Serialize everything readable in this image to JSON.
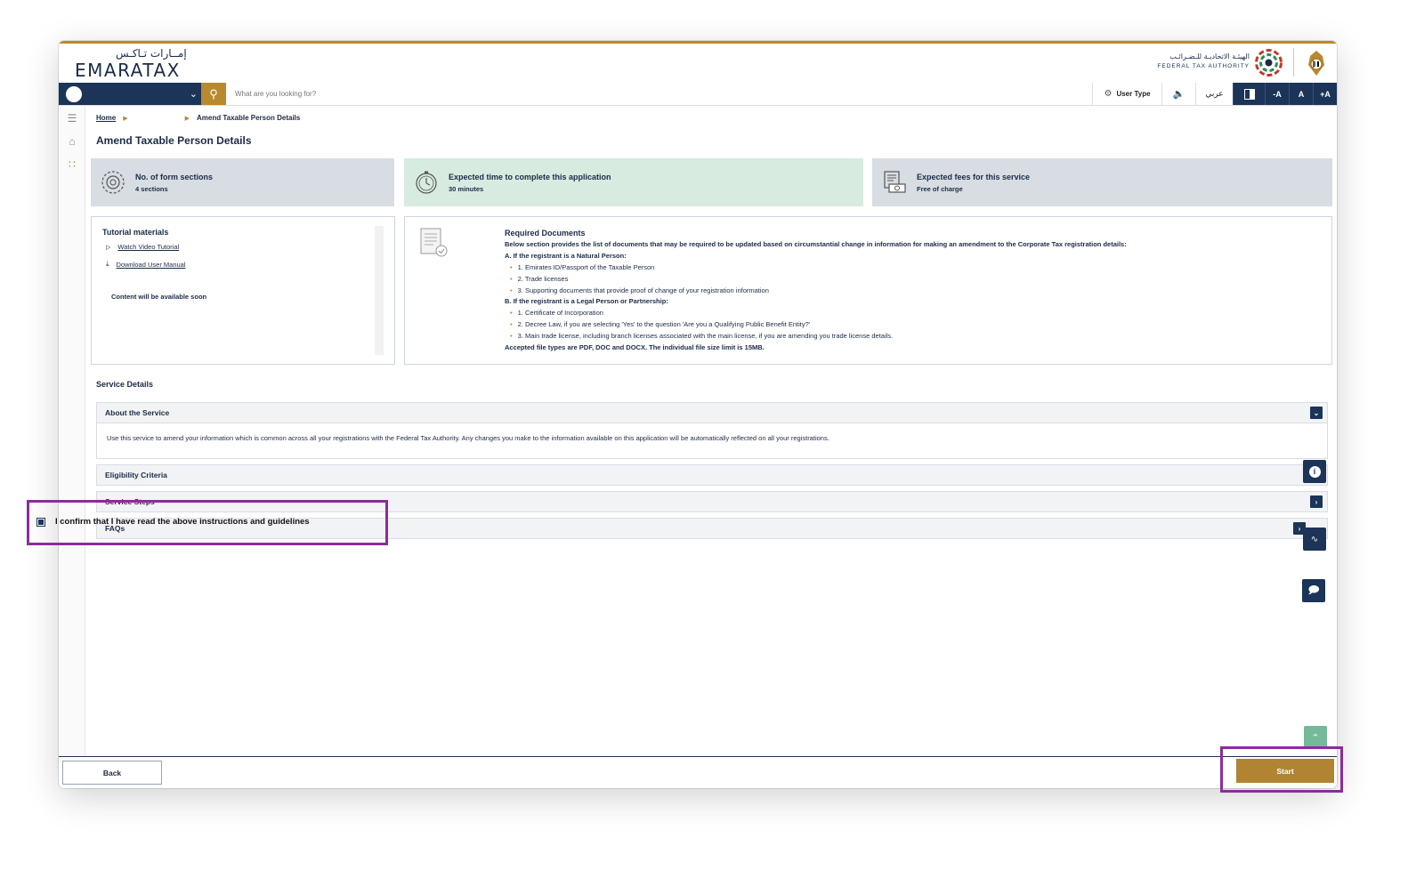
{
  "logo": {
    "arabic": "إمــارات تـاكـس",
    "english": "EMARATAX"
  },
  "authority": {
    "arabic": "الهيئـة الاتحاديـة للـضـرائـب",
    "english": "FEDERAL TAX AUTHORITY"
  },
  "topbar": {
    "search_placeholder": "What are you looking for?",
    "user_type": "User Type",
    "language": "عربي",
    "font_decrease": "-A",
    "font_normal": "A",
    "font_increase": "+A"
  },
  "breadcrumb": {
    "home": "Home",
    "current": "Amend Taxable Person Details"
  },
  "page_title": "Amend Taxable Person Details",
  "info_cards": [
    {
      "title": "No. of form sections",
      "value": "4 sections",
      "bg": "#d8dde3"
    },
    {
      "title": "Expected time to complete this application",
      "value": "30 minutes",
      "bg": "#d7ebe0"
    },
    {
      "title": "Expected fees for this service",
      "value": "Free of charge",
      "bg": "#d8dde3"
    }
  ],
  "tutorial": {
    "title": "Tutorial materials",
    "video_link": "Watch Video Tutorial",
    "manual_link": "Download User Manual",
    "note": "Content will be available soon"
  },
  "required_documents": {
    "title": "Required Documents",
    "intro": "Below section provides the list of documents that may be required to be updated based on circumstantial change in information for making an amendment to the Corporate Tax registration details:",
    "section_a": "A. If the registrant is a Natural Person:",
    "a_items": [
      "1. Emirates ID/Passport of the Taxable Person",
      "2. Trade licenses",
      "3. Supporting documents that provide proof of change of your registration information"
    ],
    "section_b": "B. If the registrant is a Legal Person or Partnership:",
    "b_items": [
      "1. Certificate of Incorporation",
      "2. Decree Law, if you are selecting 'Yes' to the question 'Are you a Qualifying Public Benefit Entity?'",
      "3. Main trade license, including branch licenses associated with the main license, if you are amending you trade license details."
    ],
    "file_note": "Accepted file types are PDF, DOC and DOCX. The individual file size limit is 15MB."
  },
  "service_details": {
    "title": "Service Details",
    "about_title": "About the Service",
    "about_body": "Use this service to amend your information which is common across all your registrations with the Federal Tax Authority. Any changes you make to the information available on this application will be automatically reflected on all your registrations.",
    "eligibility": "Eligibility Criteria",
    "steps": "Service Steps",
    "faqs": "FAQs"
  },
  "confirm_text": "I confirm that I have read the above instructions and guidelines",
  "footer": {
    "back": "Back",
    "start": "Start"
  },
  "colors": {
    "navy": "#1b3457",
    "gold": "#b8892e",
    "highlight": "#8e2a9f",
    "green": "#75b99a"
  }
}
